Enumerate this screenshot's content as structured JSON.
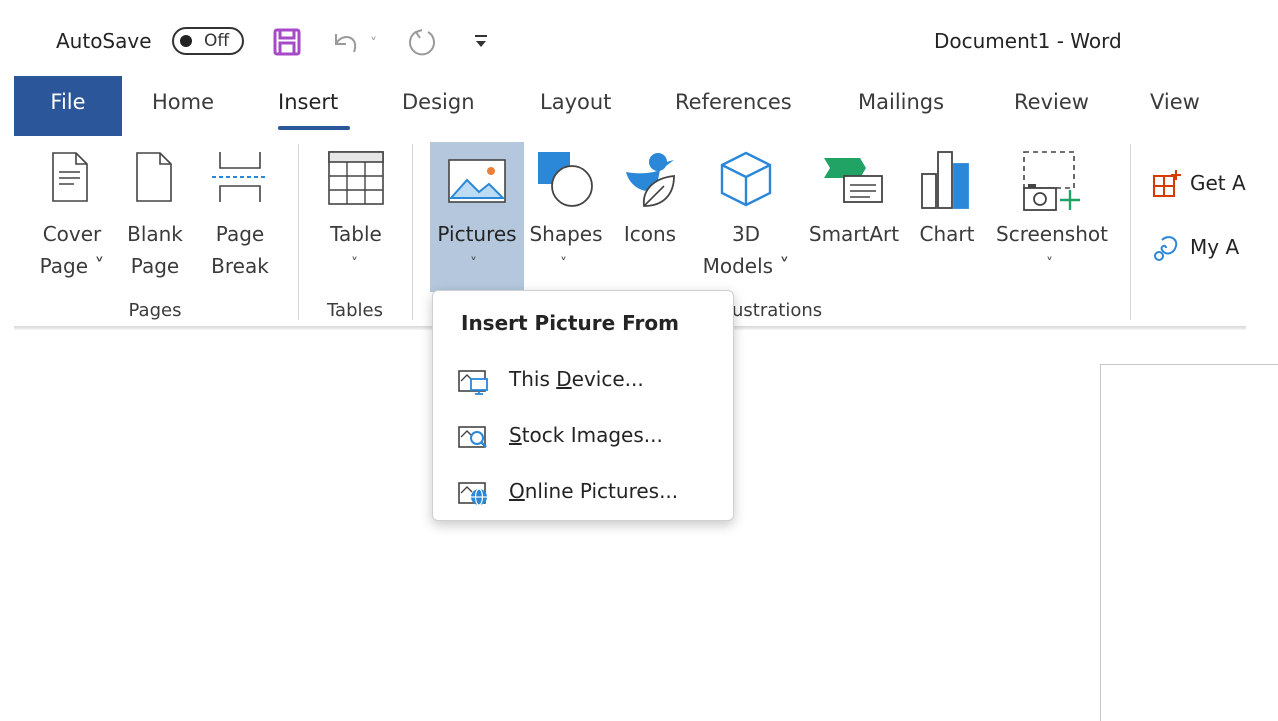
{
  "titlebar": {
    "autosave_label": "AutoSave",
    "autosave_state": "Off",
    "doc_title": "Document1  -  Word",
    "icons": [
      "save-icon",
      "undo-icon",
      "redo-icon",
      "customize-qat-icon"
    ]
  },
  "tabs": [
    "File",
    "Home",
    "Insert",
    "Design",
    "Layout",
    "References",
    "Mailings",
    "Review",
    "View"
  ],
  "active_tab": "Insert",
  "ribbon": {
    "pages": {
      "group_label": "Pages",
      "cover_page": [
        "Cover",
        "Page ˅"
      ],
      "blank_page": [
        "Blank",
        "Page"
      ],
      "page_break": [
        "Page",
        "Break"
      ]
    },
    "tables": {
      "group_label": "Tables",
      "table": "Table"
    },
    "illustrations": {
      "group_label_visible": "ustrations",
      "pictures": "Pictures",
      "shapes": "Shapes",
      "icons": "Icons",
      "models": [
        "3D",
        "Models ˅"
      ],
      "smartart": "SmartArt",
      "chart": "Chart",
      "screenshot": "Screenshot"
    },
    "addins": {
      "get_addins": "Get A",
      "my_addins": "My A"
    }
  },
  "dropdown": {
    "title": "Insert Picture From",
    "items": [
      {
        "pre": "This ",
        "key": "D",
        "post": "evice...",
        "icon": "device-picture-icon"
      },
      {
        "pre": "",
        "key": "S",
        "post": "tock Images...",
        "icon": "stock-images-icon"
      },
      {
        "pre": "",
        "key": "O",
        "post": "nline Pictures...",
        "icon": "online-pictures-icon"
      }
    ]
  },
  "colors": {
    "accent": "#2b579a",
    "pressed": "#b4c7dc",
    "save_purple": "#a64ac9",
    "icon_blue": "#2b88d8",
    "icon_green": "#21a366",
    "addin_red": "#d83b01"
  }
}
